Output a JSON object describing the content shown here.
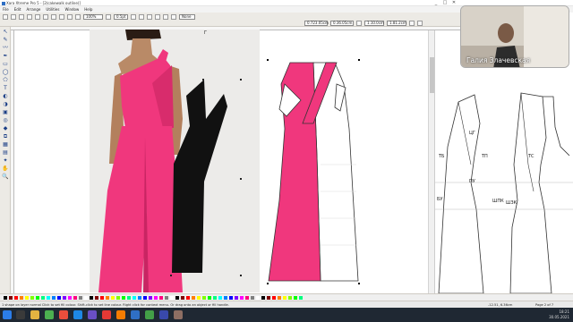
{
  "window": {
    "title": "Xara Xtreme Pro 5 - [2(cakewalk outline)]",
    "controls": [
      "_",
      "□",
      "✕"
    ]
  },
  "menu": [
    "File",
    "Edit",
    "Arrange",
    "Utilities",
    "Window",
    "Help"
  ],
  "toolbar": {
    "zoom": "100%",
    "line_width": "0.5pt",
    "pos_x": "0.723.05cm",
    "pos_y": "0.36.05cm",
    "size_w": "1.10.0cm",
    "size_h": "1.81.2cm",
    "fill_mode": "None"
  },
  "workspace": {
    "ruler_marker": "Г",
    "pattern_labels": {
      "cg": "ЦГ",
      "tb": "ТБ",
      "tp": "ТП",
      "pu": "ПУ",
      "bu": "БУ",
      "shpk": "ШПК",
      "shzk": "ШЗК",
      "ts": "ТС"
    }
  },
  "colors": {
    "pink": "#f0377d",
    "pink_light": "#ff69a0",
    "black": "#111111",
    "toolbar_bg": "#eceae5",
    "taskbar_bg": "#1f2833",
    "accent": "#2f6fc4"
  },
  "status": {
    "hint": "1 shape on layer normal Click to set fill colour. Shift-click to set line colour. Right click for context menu. Or drag onto an object or fill handle.",
    "coords": "-12.51, 6.36cm",
    "page": "Page 2 of 7"
  },
  "tray": {
    "time": "18:21",
    "date": "30.05.2021"
  },
  "video_call": {
    "participant": "Галия Злачевская"
  }
}
